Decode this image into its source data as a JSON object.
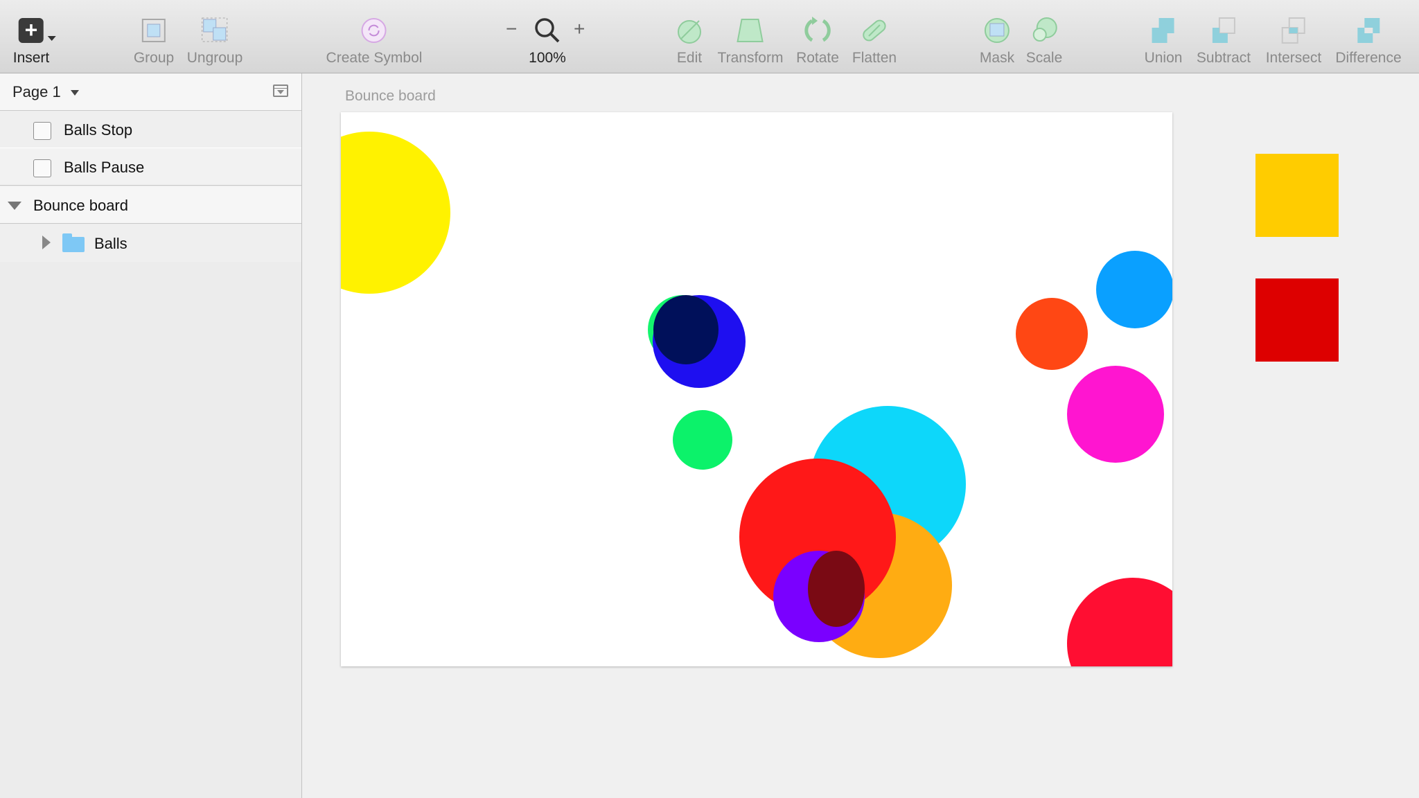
{
  "toolbar": {
    "insert": "Insert",
    "group": "Group",
    "ungroup": "Ungroup",
    "create_symbol": "Create Symbol",
    "zoom_minus": "−",
    "zoom_plus": "+",
    "zoom_level": "100%",
    "edit": "Edit",
    "transform": "Transform",
    "rotate": "Rotate",
    "flatten": "Flatten",
    "mask": "Mask",
    "scale": "Scale",
    "union": "Union",
    "subtract": "Subtract",
    "intersect": "Intersect",
    "difference": "Difference"
  },
  "sidebar": {
    "page": "Page 1",
    "layers": [
      {
        "label": "Balls Stop",
        "type": "checkbox"
      },
      {
        "label": "Balls Pause",
        "type": "checkbox"
      },
      {
        "label": "Bounce board",
        "type": "artboard"
      },
      {
        "label": "Balls",
        "type": "folder"
      }
    ]
  },
  "canvas": {
    "artboard_title": "Bounce board",
    "ball_colors": [
      "#fff200",
      "#14f56e",
      "#1e0ff0",
      "#00105a",
      "#0cf26a",
      "#ff1818",
      "#0dd7fa",
      "#ffac12",
      "#0a8a10",
      "#7a0a14",
      "#7a00ff",
      "#ff4714",
      "#0aa0ff",
      "#ff15d0",
      "#ff0e32"
    ],
    "square_colors": [
      "#ffcc00",
      "#dd0000"
    ]
  }
}
